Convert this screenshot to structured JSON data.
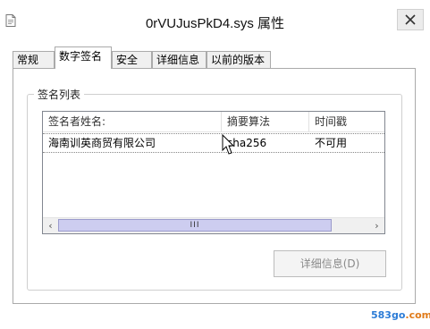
{
  "window": {
    "title": "0rVUJusPkD4.sys 属性"
  },
  "tabs": [
    {
      "label": "常规",
      "active": false
    },
    {
      "label": "数字签名",
      "active": true
    },
    {
      "label": "安全",
      "active": false
    },
    {
      "label": "详细信息",
      "active": false
    },
    {
      "label": "以前的版本",
      "active": false
    }
  ],
  "signature_list": {
    "group_label": "签名列表",
    "columns": [
      "签名者姓名:",
      "摘要算法",
      "时间戳"
    ],
    "rows": [
      {
        "name": "海南训英商贸有限公司",
        "digest": "sha256",
        "timestamp": "不可用"
      }
    ],
    "scrollbar": {
      "left_icon": "scroll-left-icon",
      "right_icon": "scroll-right-icon",
      "thumb_grip": "III"
    }
  },
  "details_button": {
    "label": "详细信息(D)",
    "enabled": false
  },
  "watermark": {
    "part1": "583go",
    "part2": ".com"
  },
  "colors": {
    "scroll_thumb": "#cdcdf0",
    "disabled_text": "#8a8a8a",
    "border": "#aaaaaa"
  }
}
